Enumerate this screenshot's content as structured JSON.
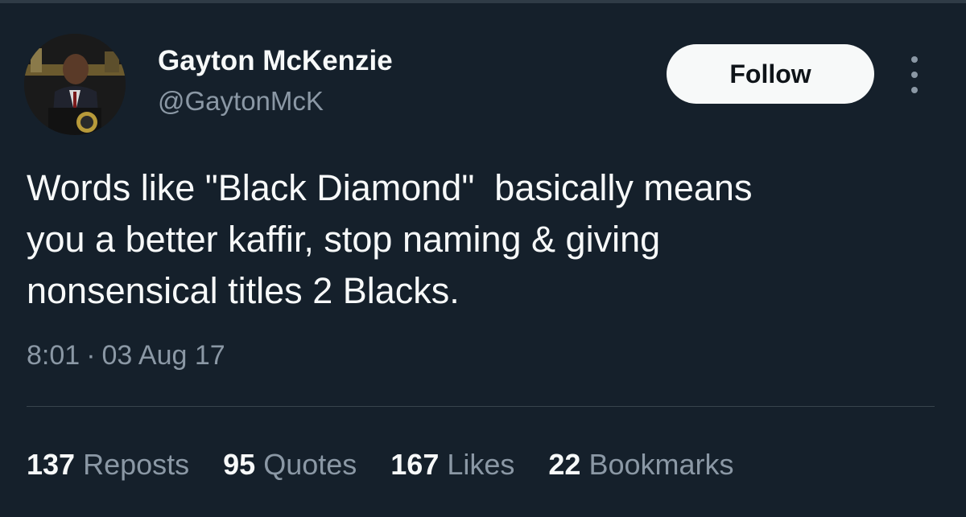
{
  "tweet": {
    "author": {
      "display_name": "Gayton McKenzie",
      "handle": "@GaytonMcK",
      "avatar_icon": "profile-photo"
    },
    "follow_label": "Follow",
    "more_icon": "more-vertical-icon",
    "text": "Words like \"Black Diamond\"  basically means\nyou a better kaffir, stop naming & giving\nnonsensical titles 2 Blacks.",
    "time": "8:01",
    "separator": "·",
    "date": "03 Aug 17",
    "stats": [
      {
        "count": "137",
        "label": "Reposts"
      },
      {
        "count": "95",
        "label": "Quotes"
      },
      {
        "count": "167",
        "label": "Likes"
      },
      {
        "count": "22",
        "label": "Bookmarks"
      }
    ]
  },
  "colors": {
    "background": "#15202b",
    "primary_text": "#f7f9f9",
    "secondary_text": "#8b98a5",
    "divider": "#38444d",
    "follow_bg": "#f7f9f9",
    "follow_text": "#0f1419"
  }
}
